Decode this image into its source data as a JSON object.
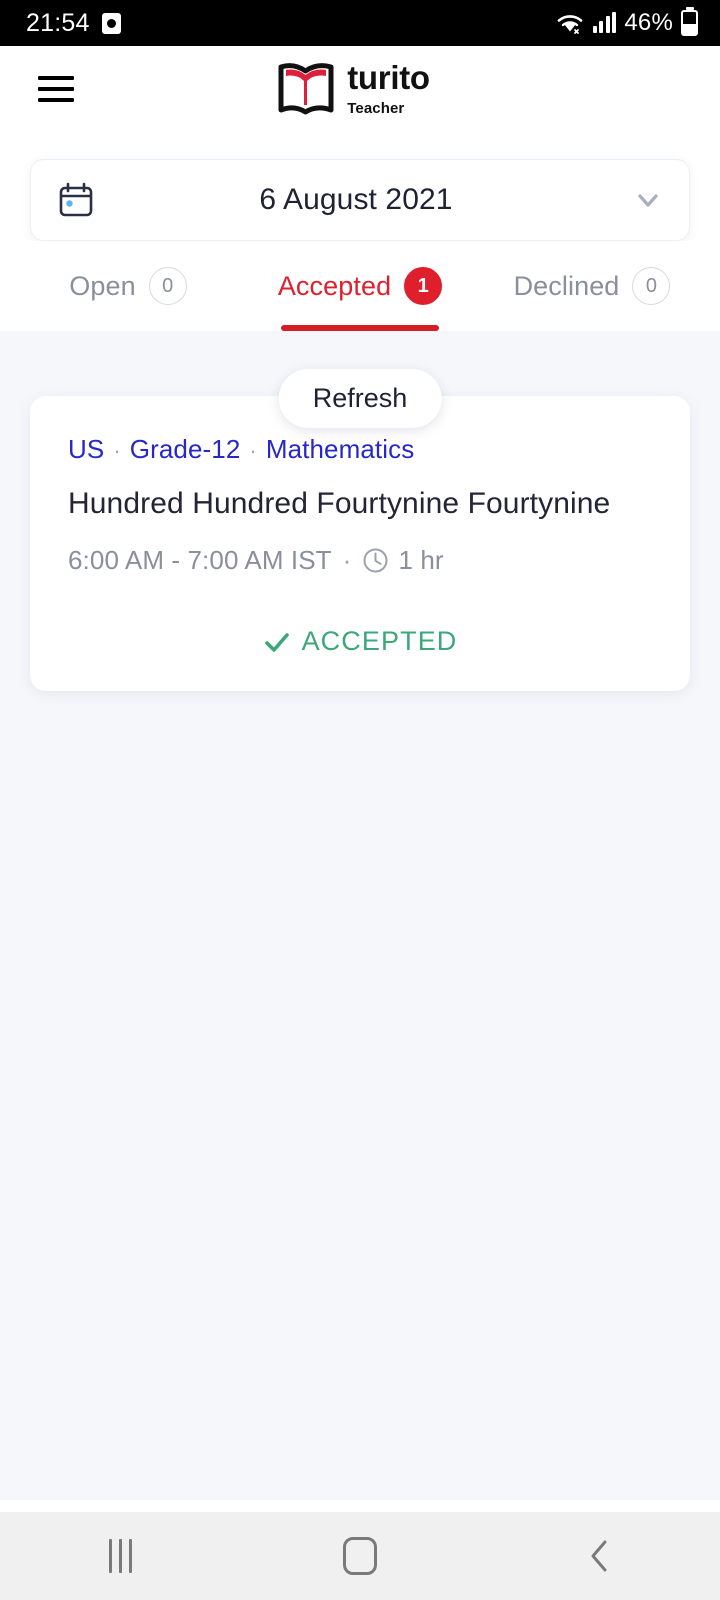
{
  "status_bar": {
    "time": "21:54",
    "app_icon": "clock-app-icon",
    "wifi_icon": "wifi-icon",
    "signal_icon": "cellular-signal-icon",
    "battery_percent": "46%",
    "battery_icon": "battery-icon"
  },
  "header": {
    "menu_icon": "hamburger-menu-icon",
    "logo_icon": "turito-book-logo",
    "brand_name": "turito",
    "brand_subtitle": "Teacher"
  },
  "date_selector": {
    "calendar_icon": "calendar-icon",
    "value": "6 August 2021",
    "chevron_icon": "chevron-down-icon"
  },
  "tabs": [
    {
      "label": "Open",
      "count": "0",
      "active": false
    },
    {
      "label": "Accepted",
      "count": "1",
      "active": true
    },
    {
      "label": "Declined",
      "count": "0",
      "active": false
    }
  ],
  "toast": {
    "label": "Refresh"
  },
  "session_card": {
    "country": "US",
    "grade": "Grade-12",
    "subject": "Mathematics",
    "separator": "·",
    "title": "Hundred Hundred Fourtynine Fourtynine",
    "time_range": "6:00 AM - 7:00 AM IST",
    "duration": "1 hr",
    "clock_icon": "clock-icon",
    "status_label": "ACCEPTED",
    "status_icon": "check-icon"
  },
  "nav_bar": {
    "recents_icon": "recents-icon",
    "home_icon": "home-icon",
    "back_icon": "back-icon"
  },
  "colors": {
    "brand_red": "#e01f2d",
    "accent_blue": "#2828c8",
    "status_green": "#3aa878",
    "page_bg": "#f5f7fb",
    "text_dark": "#242436",
    "text_muted": "#8a8f9c"
  }
}
